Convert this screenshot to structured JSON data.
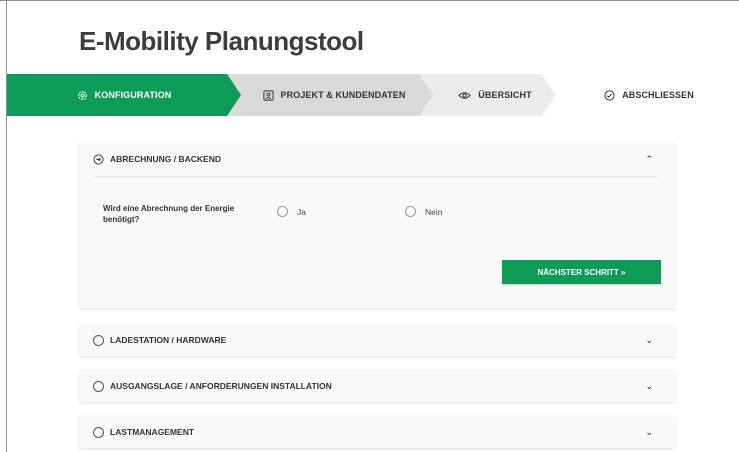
{
  "app": {
    "title": "E-Mobility Planungstool"
  },
  "stepper": {
    "steps": [
      {
        "label": "KONFIGURATION",
        "icon": "gear-icon",
        "active": true
      },
      {
        "label": "PROJEKT & KUNDENDATEN",
        "icon": "contact-card-icon",
        "active": false
      },
      {
        "label": "ÜBERSICHT",
        "icon": "eye-icon",
        "active": false
      },
      {
        "label": "ABSCHLIESSEN",
        "icon": "check-circle-icon",
        "active": false
      }
    ]
  },
  "sections": {
    "billing": {
      "title": "ABRECHNUNG / BACKEND",
      "icon": "arrow-circle-icon",
      "toggle_icon": "chevron-double-up-icon",
      "question": "Wird eine Abrechnung der Energie benötigt?",
      "options": [
        "Ja",
        "Nein"
      ],
      "next_label": "NÄCHSTER SCHRITT  »"
    },
    "collapsed": [
      {
        "title": "LADESTATION / HARDWARE"
      },
      {
        "title": "AUSGANGSLAGE / ANFORDERUNGEN INSTALLATION"
      },
      {
        "title": "LASTMANAGEMENT"
      }
    ],
    "collapsed_toggle_icon": "chevron-double-down-icon"
  },
  "colors": {
    "accent": "#0e9a57",
    "step_inactive": "#d9d9d9",
    "card_bg": "#f9f9f9"
  }
}
